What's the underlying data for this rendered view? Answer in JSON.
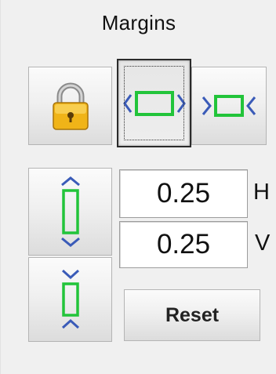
{
  "title": "Margins",
  "lock_button": {
    "icon": "padlock-icon"
  },
  "margin_modes": {
    "expand": {
      "icon": "expand-margins-icon",
      "selected": true
    },
    "shrink": {
      "icon": "shrink-margins-icon",
      "selected": false
    }
  },
  "vertical_modes": {
    "expand": {
      "icon": "expand-vertical-icon"
    },
    "shrink": {
      "icon": "shrink-vertical-icon"
    }
  },
  "horizontal": {
    "value": "0.25",
    "axis_label": "H"
  },
  "vertical": {
    "value": "0.25",
    "axis_label": "V"
  },
  "reset_label": "Reset",
  "colors": {
    "icon_green": "#22c43a",
    "arrow_blue": "#3a5bb8",
    "lock_gold": "#f0b418"
  }
}
